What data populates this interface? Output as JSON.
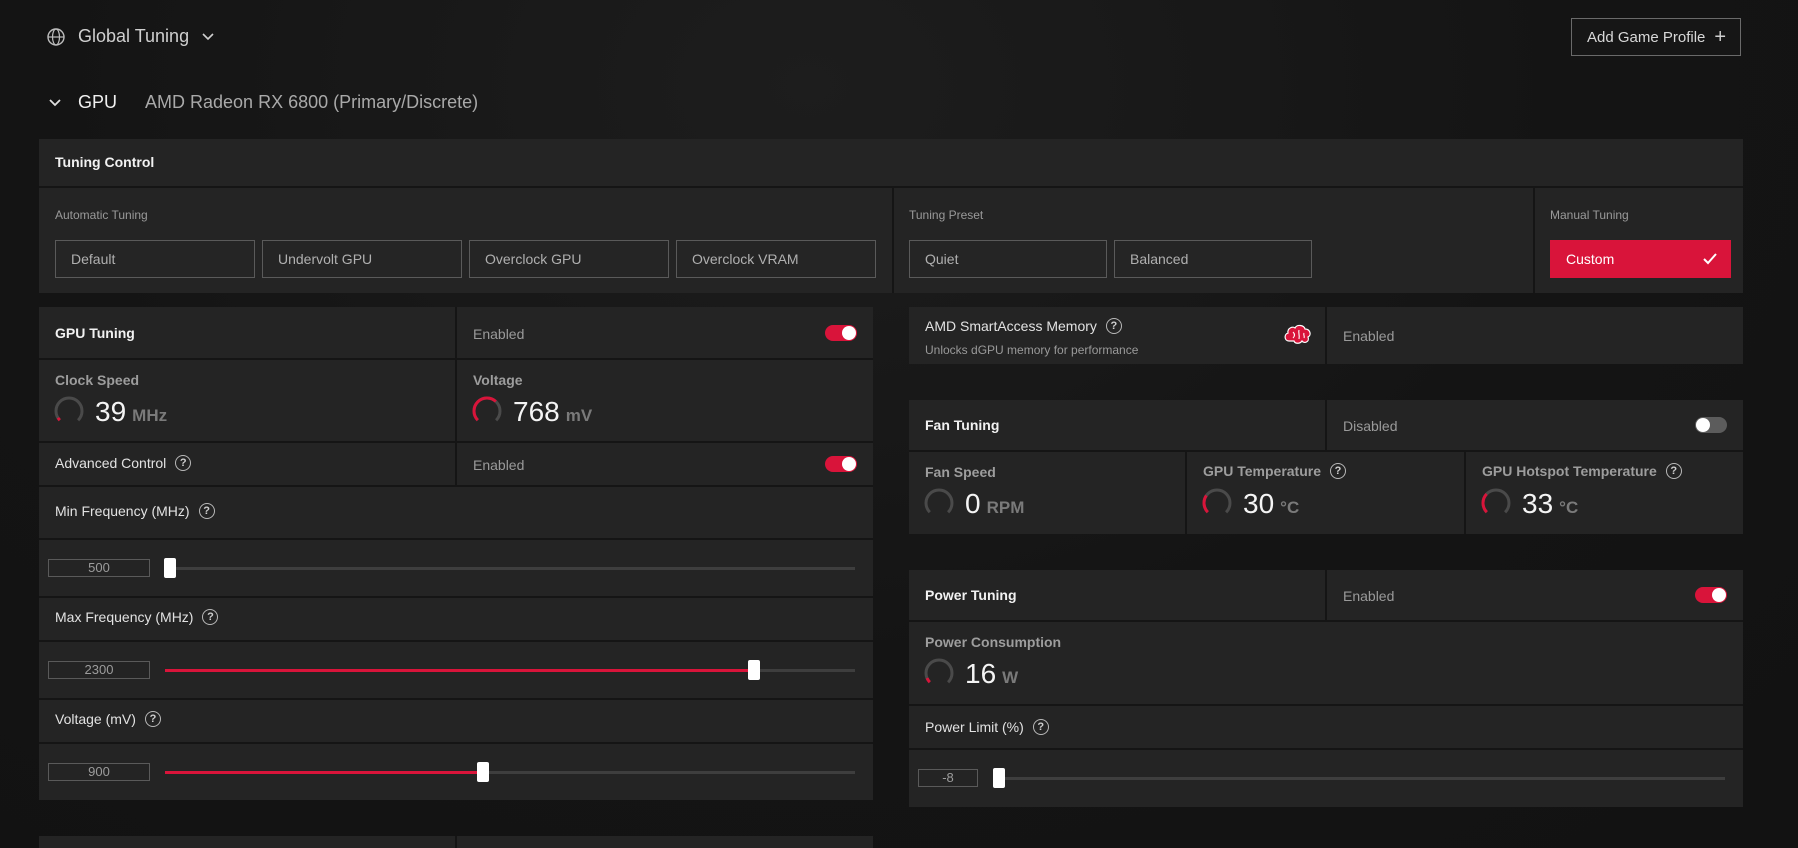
{
  "top": {
    "profile_label": "Global Tuning",
    "add_profile_label": "Add Game Profile",
    "gpu_label": "GPU",
    "gpu_name": "AMD Radeon RX 6800 (Primary/Discrete)"
  },
  "tuning_control": {
    "title": "Tuning Control",
    "automatic_label": "Automatic Tuning",
    "automatic_buttons": [
      "Default",
      "Undervolt GPU",
      "Overclock GPU",
      "Overclock VRAM"
    ],
    "preset_label": "Tuning Preset",
    "preset_buttons": [
      "Quiet",
      "Balanced"
    ],
    "manual_label": "Manual Tuning",
    "manual_button": "Custom"
  },
  "gpu_tuning": {
    "title": "GPU Tuning",
    "status": "Enabled",
    "enabled": true,
    "clock_label": "Clock Speed",
    "clock_value": "39",
    "clock_unit": "MHz",
    "voltage_label": "Voltage",
    "voltage_value": "768",
    "voltage_unit": "mV",
    "advanced_label": "Advanced Control",
    "advanced_status": "Enabled",
    "advanced_enabled": true,
    "min_freq_label": "Min Frequency (MHz)",
    "min_freq_value": "500",
    "max_freq_label": "Max Frequency (MHz)",
    "max_freq_value": "2300",
    "voltage_mv_label": "Voltage (mV)",
    "voltage_mv_value": "900"
  },
  "smart_access": {
    "title": "AMD SmartAccess Memory",
    "subtitle": "Unlocks dGPU memory for performance",
    "status": "Enabled"
  },
  "fan_tuning": {
    "title": "Fan Tuning",
    "status": "Disabled",
    "enabled": false,
    "fan_speed_label": "Fan Speed",
    "fan_speed_value": "0",
    "fan_speed_unit": "RPM",
    "gpu_temp_label": "GPU Temperature",
    "gpu_temp_value": "30",
    "gpu_temp_unit": "°C",
    "hotspot_label": "GPU Hotspot Temperature",
    "hotspot_value": "33",
    "hotspot_unit": "°C"
  },
  "power_tuning": {
    "title": "Power Tuning",
    "status": "Enabled",
    "enabled": true,
    "consumption_label": "Power Consumption",
    "consumption_value": "16",
    "consumption_unit": "W",
    "limit_label": "Power Limit (%)",
    "limit_value": "-8"
  },
  "help_glyph": "?",
  "icons": [
    "globe-icon",
    "chevron-down-icon",
    "plus-icon",
    "check-icon",
    "help-icon",
    "brain-icon"
  ],
  "colors": {
    "accent": "#d9143a",
    "panel": "#242424",
    "background": "#141414"
  }
}
